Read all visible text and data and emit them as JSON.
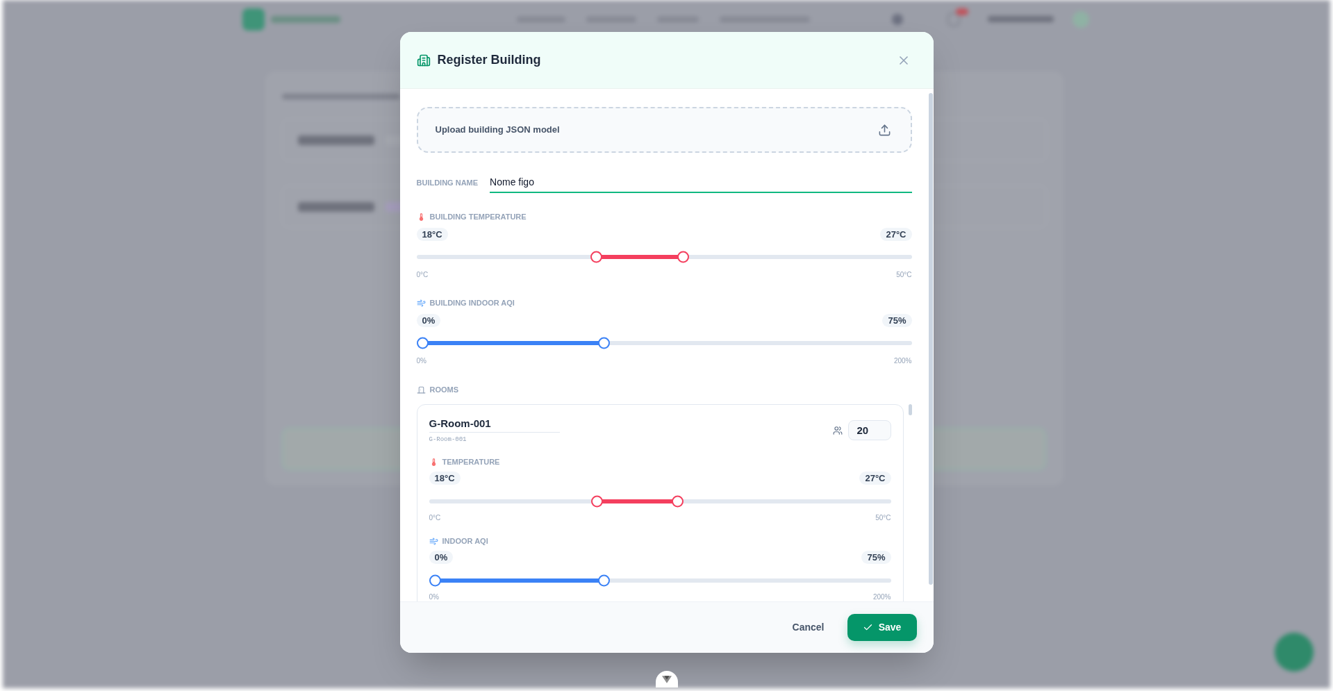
{
  "modal": {
    "title": "Register Building",
    "upload": {
      "label": "Upload building JSON model"
    },
    "building_name": {
      "label": "BUILDING NAME",
      "value": "Nome figo"
    },
    "building_ranges": [
      {
        "kind": "temperature",
        "label": "BUILDING TEMPERATURE",
        "low_reading": "18°C",
        "high_reading": "27°C",
        "min_label": "0°C",
        "max_label": "50°C",
        "thumbs": [
          {
            "level": 0.36
          },
          {
            "level": 0.54
          }
        ]
      },
      {
        "kind": "aqi",
        "label": "BUILDING INDOOR AQI",
        "low_reading": "0%",
        "high_reading": "75%",
        "min_label": "0%",
        "max_label": "200%",
        "thumbs": [
          {
            "level": 0
          },
          {
            "level": 0.375
          }
        ]
      }
    ],
    "rooms": {
      "label": "ROOMS",
      "items": [
        {
          "name": "G-Room-001",
          "code": "G-Room-001",
          "capacity": "20",
          "ranges": [
            {
              "kind": "temperature",
              "label": "TEMPERATURE",
              "low_reading": "18°C",
              "high_reading": "27°C",
              "min_label": "0°C",
              "max_label": "50°C",
              "thumbs": [
                {
                  "level": 0.36
                },
                {
                  "level": 0.54
                }
              ]
            },
            {
              "kind": "aqi",
              "label": "INDOOR AQI",
              "low_reading": "0%",
              "high_reading": "75%",
              "min_label": "0%",
              "max_label": "200%",
              "thumbs": [
                {
                  "level": 0
                },
                {
                  "level": 0.375
                }
              ]
            }
          ]
        }
      ]
    },
    "footer": {
      "buttons": [
        {
          "kind": "cancel",
          "label": "Cancel"
        },
        {
          "kind": "save",
          "label": "Save"
        }
      ]
    }
  }
}
